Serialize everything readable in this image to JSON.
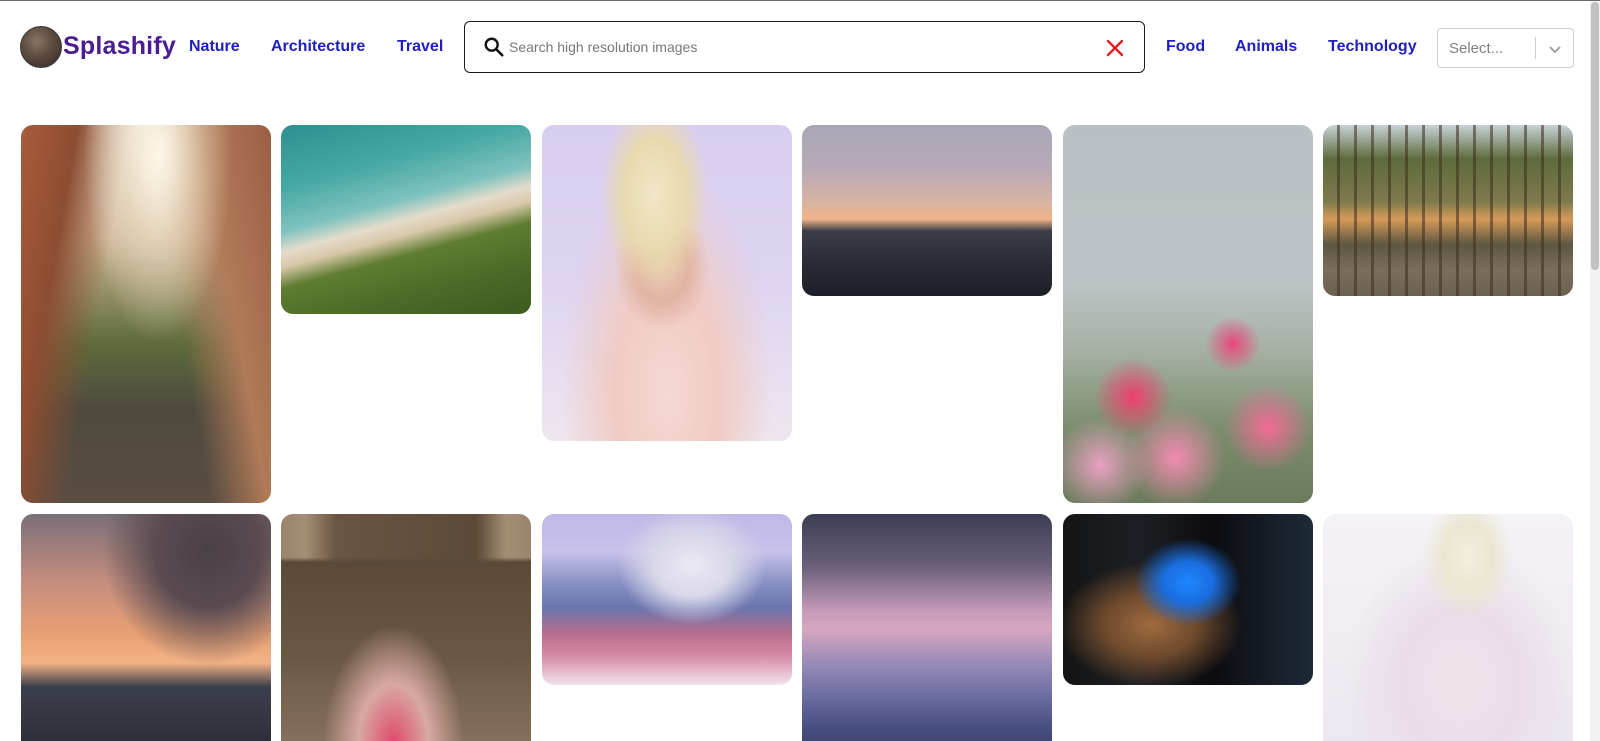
{
  "brand": {
    "name": "Splashify"
  },
  "nav_left": [
    "Nature",
    "Architecture",
    "Travel"
  ],
  "nav_right": [
    "Food",
    "Animals",
    "Technology"
  ],
  "search": {
    "placeholder": "Search high resolution images",
    "value": ""
  },
  "select": {
    "value": "Select..."
  },
  "colors": {
    "brand": "#4b1d8f",
    "link": "#1f1fbf",
    "clear_icon": "#e02020"
  },
  "icons": [
    "search-icon",
    "clear-icon",
    "chevron-down-icon"
  ],
  "gallery": [
    {
      "subject": "canyon-hiker"
    },
    {
      "subject": "aerial-beach"
    },
    {
      "subject": "portrait-blond-pink-sweater"
    },
    {
      "subject": "ocean-sunset"
    },
    {
      "subject": "pink-flowers"
    },
    {
      "subject": "palm-grove"
    },
    {
      "subject": "sea-sunset-silhouettes"
    },
    {
      "subject": "woman-in-doorway"
    },
    {
      "subject": "snowy-mountain-forest"
    },
    {
      "subject": "purple-mountain-haze"
    },
    {
      "subject": "underwater-diver"
    },
    {
      "subject": "portrait-white-sweater"
    }
  ]
}
